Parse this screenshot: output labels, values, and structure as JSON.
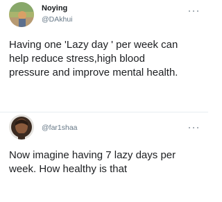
{
  "tweets": [
    {
      "display_name": "Noying",
      "handle": "@DAkhui",
      "text_lines": [
        "Having one 'Lazy day ' per week can",
        "help reduce stress,high blood",
        "pressure and improve mental health."
      ],
      "more_icon": "more-dots-icon"
    },
    {
      "handle": "@far1shaa",
      "text_lines": [
        "Now imagine having 7 lazy days per",
        "week. How healthy is that"
      ],
      "more_icon": "more-dots-icon"
    }
  ],
  "colors": {
    "text": "#14171a",
    "secondary_text": "#657786",
    "divider": "#e6ecf0",
    "background": "#ffffff"
  }
}
